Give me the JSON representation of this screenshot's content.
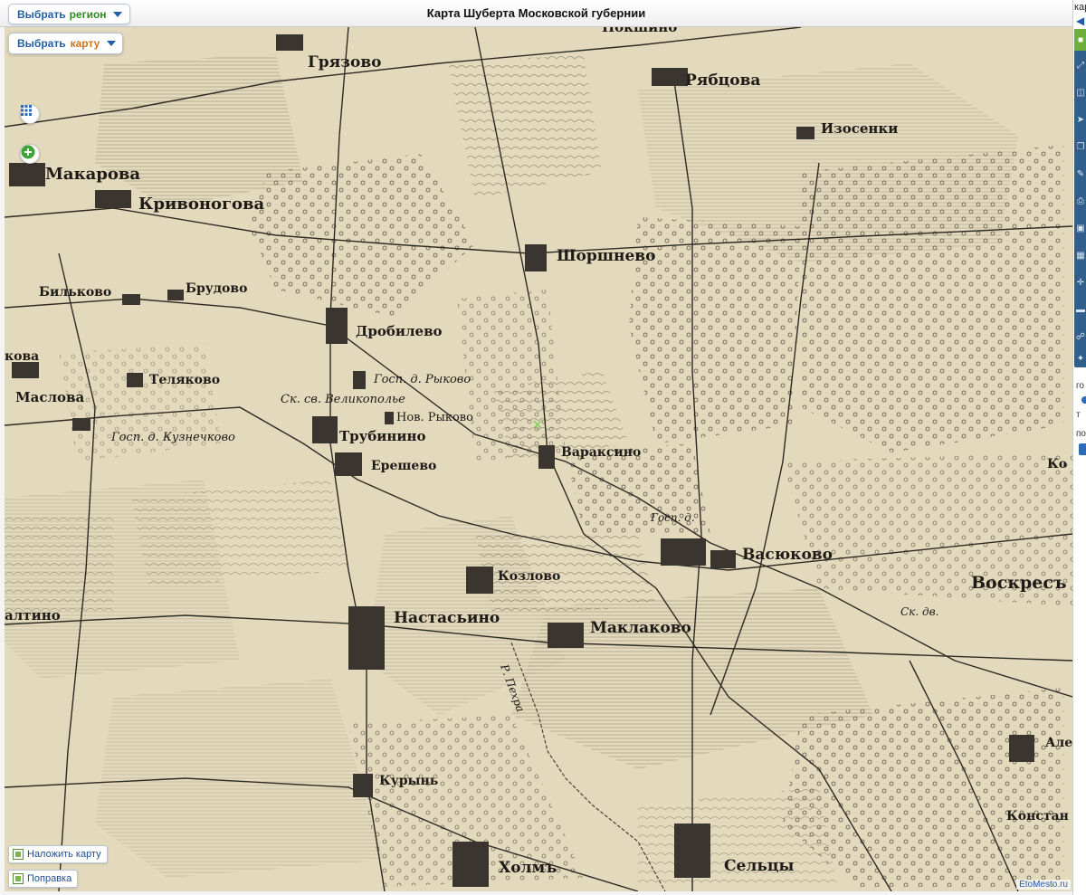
{
  "header": {
    "title": "Карта Шуберта Московской губернии",
    "region_button": {
      "prefix": "Выбрать",
      "word": "регион"
    },
    "map_button": {
      "prefix": "Выбрать",
      "word": "карту"
    }
  },
  "map": {
    "labels": {
      "gryazovo": "Грязово",
      "ryabtsova": "Рябцова",
      "pokshino": "Покшино",
      "izosenki": "Изосенки",
      "makarova": "Макарова",
      "krivonogova": "Кривоногова",
      "shorshnevo": "Шоршнево",
      "bilkovo": "Бильково",
      "brudovo": "Брудово",
      "drobilevo": "Дробилево",
      "kova": "кова",
      "telyakovo": "Теляково",
      "maslova": "Маслова",
      "gosp_rykovo": "Госп. д. Рыково",
      "sk_velikopolye": "Ск. св. Великополье",
      "nov_rykovo": "Нов. Рыково",
      "gosp_kuznechkovo": "Госп. д. Кузнечково",
      "trubinino": "Трубинино",
      "varaksino": "Вараксино",
      "yereshevo": "Ерешево",
      "gosp_d": "Госп. д.",
      "vasyukovo": "Васюково",
      "kozlovo": "Козлово",
      "voskr": "Воскресъ",
      "altino": "алтино",
      "nastasyino": "Настасьино",
      "maklakovo": "Маклаково",
      "sk_dv": "Ск. дв.",
      "r_pekhra": "Р. Пехра",
      "kuryn": "Курынь",
      "ale": "Але",
      "konstan": "Констан",
      "kholm": "Холмъ",
      "seltsy": "Сельцы",
      "ko": "Ко"
    }
  },
  "controls": {
    "grid_icon": "grid-icon",
    "zoom_icon": "plus-icon",
    "overlay_button": "Наложить карту",
    "fix_button": "Поправка"
  },
  "copyright": "EtoMesto.ru",
  "right_panel": {
    "cut_title": "кар",
    "cut_text_1": "го",
    "cut_text_2": "т",
    "cut_text_3": "по"
  }
}
